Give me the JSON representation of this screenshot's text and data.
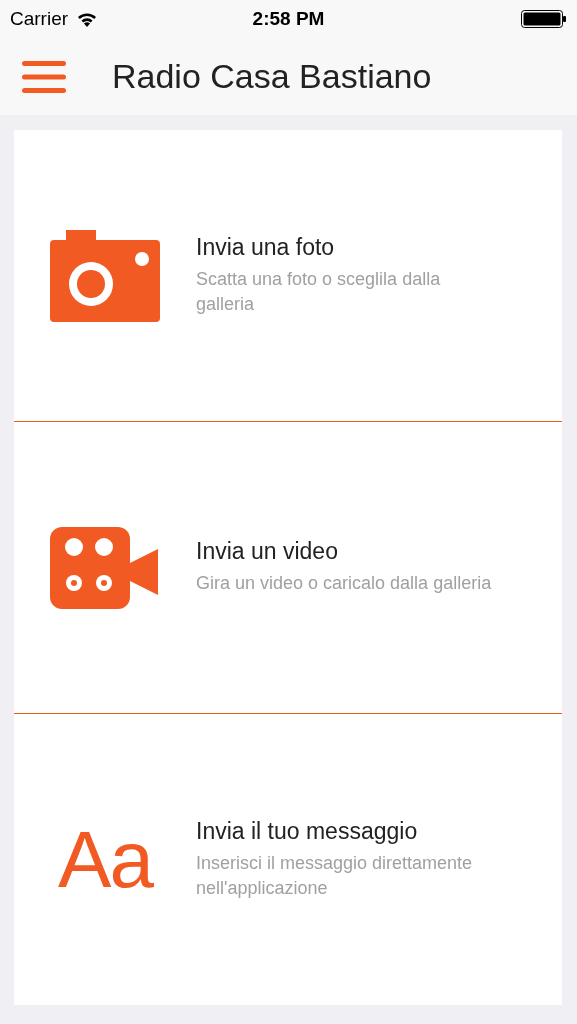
{
  "status_bar": {
    "carrier": "Carrier",
    "time": "2:58 PM"
  },
  "nav_bar": {
    "title": "Radio Casa Bastiano"
  },
  "options": [
    {
      "kind": "camera",
      "title": "Invia una foto",
      "subtitle": "Scatta una foto o sceglila dalla galleria"
    },
    {
      "kind": "video",
      "title": "Invia un video",
      "subtitle": "Gira un video o caricalo dalla galleria"
    },
    {
      "kind": "text",
      "glyph": "Aa",
      "title": "Invia il tuo messaggio",
      "subtitle": "Inserisci il messaggio direttamente nell'applicazione"
    }
  ]
}
